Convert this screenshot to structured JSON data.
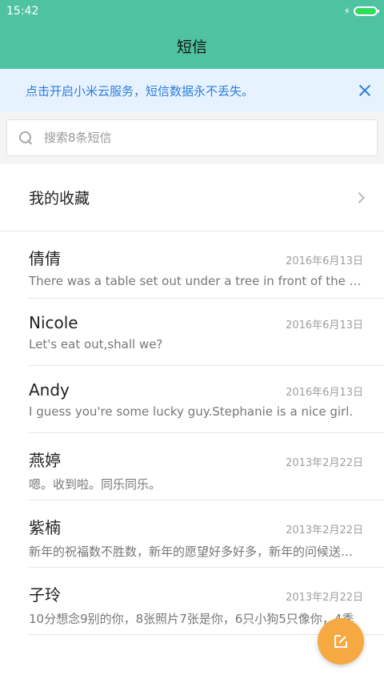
{
  "status_bar": {
    "time": "15:42"
  },
  "header": {
    "title": "短信"
  },
  "notice": {
    "text": "点击开启小米云服务，短信数据永不丢失。"
  },
  "search": {
    "placeholder": "搜索8条短信"
  },
  "favorites": {
    "label": "我的收藏"
  },
  "conversations": [
    {
      "name": "倩倩",
      "date": "2016年6月13日",
      "preview": "There was a table set out under a tree in front of the house"
    },
    {
      "name": "Nicole",
      "date": "2016年6月13日",
      "preview": "Let's eat out,shall we?"
    },
    {
      "name": "Andy",
      "date": "2016年6月13日",
      "preview": "I guess you're some lucky guy.Stephanie is a nice girl."
    },
    {
      "name": "燕婷",
      "date": "2013年2月22日",
      "preview": "嗯。收到啦。同乐同乐。"
    },
    {
      "name": "紫楠",
      "date": "2013年2月22日",
      "preview": "新年的祝福数不胜数，新年的愿望好多好多，新年的问候送给你"
    },
    {
      "name": "子玲",
      "date": "2013年2月22日",
      "preview": "10分想念9别的你，8张照片7张是你，6只小狗5只像你，4季"
    }
  ],
  "colors": {
    "accent": "#4fc3a1",
    "notice_bg": "#e6f2ff",
    "notice_text": "#2f7fd9",
    "fab": "#f6a940"
  },
  "icons": {
    "search": "search-icon",
    "close": "close-icon",
    "chevron": "chevron-right-icon",
    "compose": "compose-icon",
    "battery": "battery-icon",
    "charging": "bolt-icon"
  }
}
